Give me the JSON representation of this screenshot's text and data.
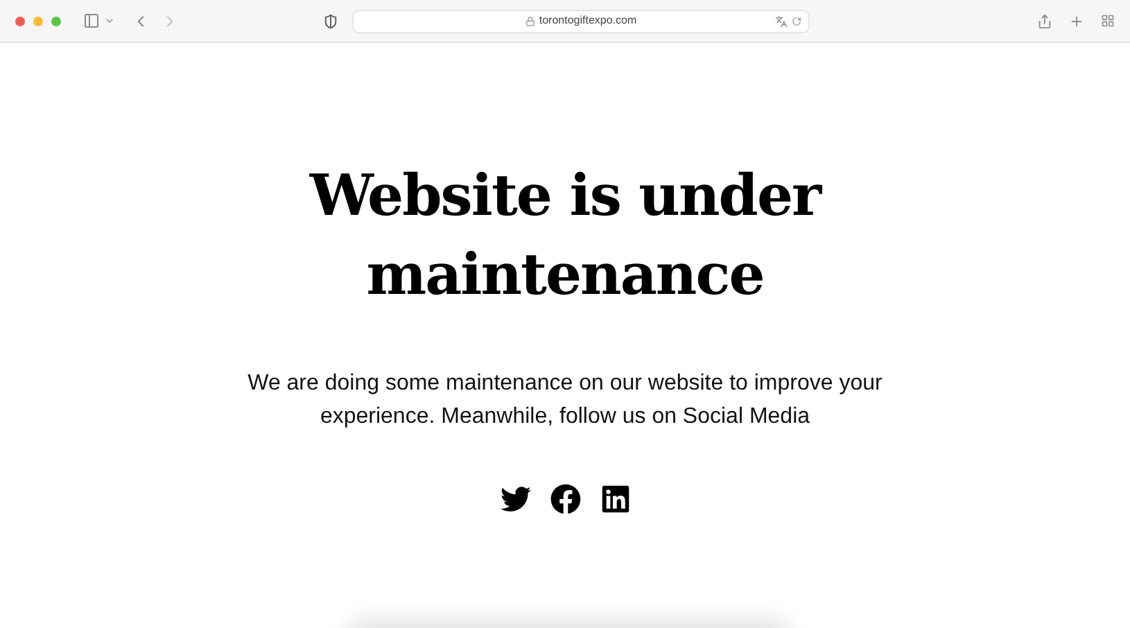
{
  "browser": {
    "url": "torontogiftexpo.com"
  },
  "page": {
    "title": "Website is under maintenance",
    "message": "We are doing some maintenance on our website to improve your experience. Meanwhile, follow us on Social Media",
    "social_links": [
      {
        "kind": "bird"
      },
      {
        "kind": "circle-f"
      },
      {
        "kind": "in-square"
      }
    ]
  }
}
